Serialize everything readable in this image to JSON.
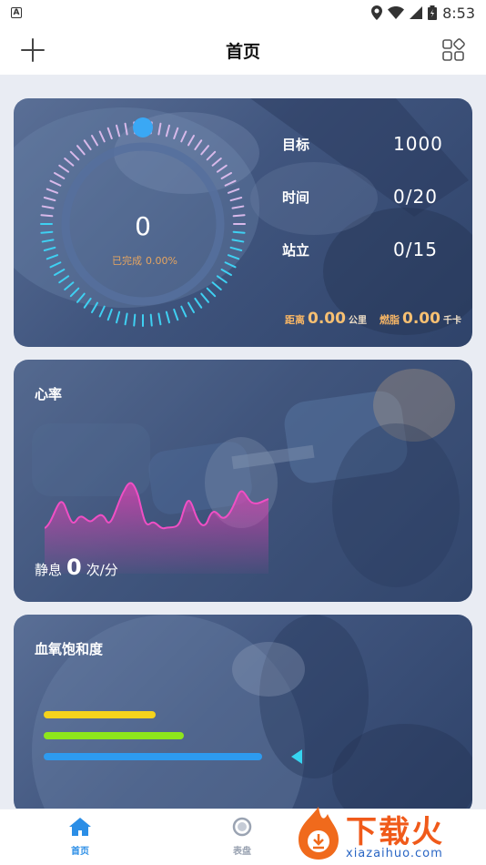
{
  "status_bar": {
    "time": "8:53",
    "badge": "A"
  },
  "app_bar": {
    "title": "首页"
  },
  "activity": {
    "steps_value": "0",
    "completed_label": "已完成",
    "completed_percent": "0.00%",
    "progress_fraction": 0.0,
    "stats": [
      {
        "label": "目标",
        "value": "1000"
      },
      {
        "label": "时间",
        "value": "0/20"
      },
      {
        "label": "站立",
        "value": "0/15"
      }
    ],
    "distance": {
      "label": "距离",
      "value": "0.00",
      "unit": "公里"
    },
    "calories": {
      "label": "燃脂",
      "value": "0.00",
      "unit": "千卡"
    }
  },
  "heart_rate": {
    "title": "心率",
    "rest_label": "静息",
    "rest_value": "0",
    "rest_unit": "次/分"
  },
  "blood_oxygen": {
    "title": "血氧饱和度",
    "bar_colors": [
      "#f5d31c",
      "#8ee61c",
      "#2d9bf0"
    ]
  },
  "bottom_nav": {
    "items": [
      {
        "label": "首页",
        "icon": "home-icon",
        "active": true
      },
      {
        "label": "表盘",
        "icon": "watch-icon",
        "active": false
      }
    ]
  },
  "watermark": {
    "text": "下载火",
    "url": "xiazaihuo.com"
  },
  "colors": {
    "accent": "#2b8ee6",
    "orange": "#f6b565",
    "pink": "#e23fb3"
  }
}
